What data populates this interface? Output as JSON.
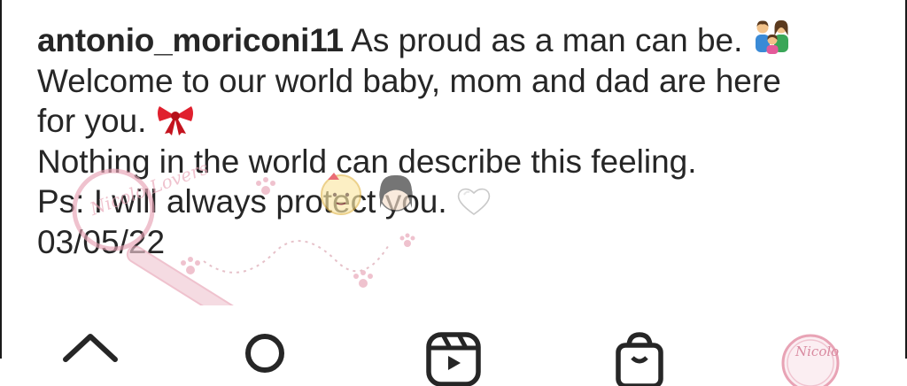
{
  "post": {
    "username": "antonio_moriconi11",
    "caption_lines": [
      "As proud as a man can be.",
      "Welcome to our world baby, mom and dad are here",
      "for you.",
      "Nothing in the world can describe this feeling.",
      "Ps: I will always protect you.",
      "03/05/22"
    ],
    "emojis": [
      "family-emoji",
      "ribbon-emoji",
      "white-heart-emoji"
    ]
  },
  "watermark": {
    "text": "Nicolo Lovers"
  },
  "navbar": {
    "items": [
      "home-icon",
      "search-icon",
      "reels-icon",
      "shop-icon",
      "profile-avatar"
    ]
  },
  "colors": {
    "text": "#262626",
    "ribbon": "#e0202e",
    "watermark": "#e8a3b5"
  }
}
